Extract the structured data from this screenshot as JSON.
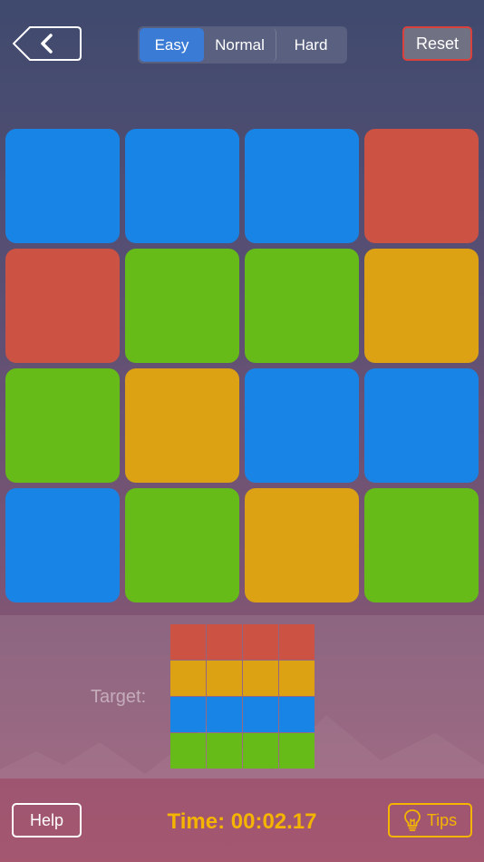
{
  "header": {
    "back_icon": "chevron-left-icon",
    "difficulty": [
      {
        "label": "Easy",
        "active": true
      },
      {
        "label": "Normal",
        "active": false
      },
      {
        "label": "Hard",
        "active": false
      }
    ],
    "reset_label": "Reset"
  },
  "colors": {
    "blue": "#1885e6",
    "red": "#cc5244",
    "green": "#66bb18",
    "yellow": "#dca214"
  },
  "board": [
    [
      "blue",
      "blue",
      "blue",
      "red"
    ],
    [
      "red",
      "green",
      "green",
      "yellow"
    ],
    [
      "green",
      "yellow",
      "blue",
      "blue"
    ],
    [
      "blue",
      "green",
      "yellow",
      "green"
    ]
  ],
  "target": {
    "label": "Target:",
    "rows": [
      "red",
      "yellow",
      "blue",
      "green"
    ]
  },
  "footer": {
    "help_label": "Help",
    "time_label": "Time:",
    "time_value": "00:02.17",
    "tips_icon": "lightbulb-icon",
    "tips_label": "Tips"
  }
}
